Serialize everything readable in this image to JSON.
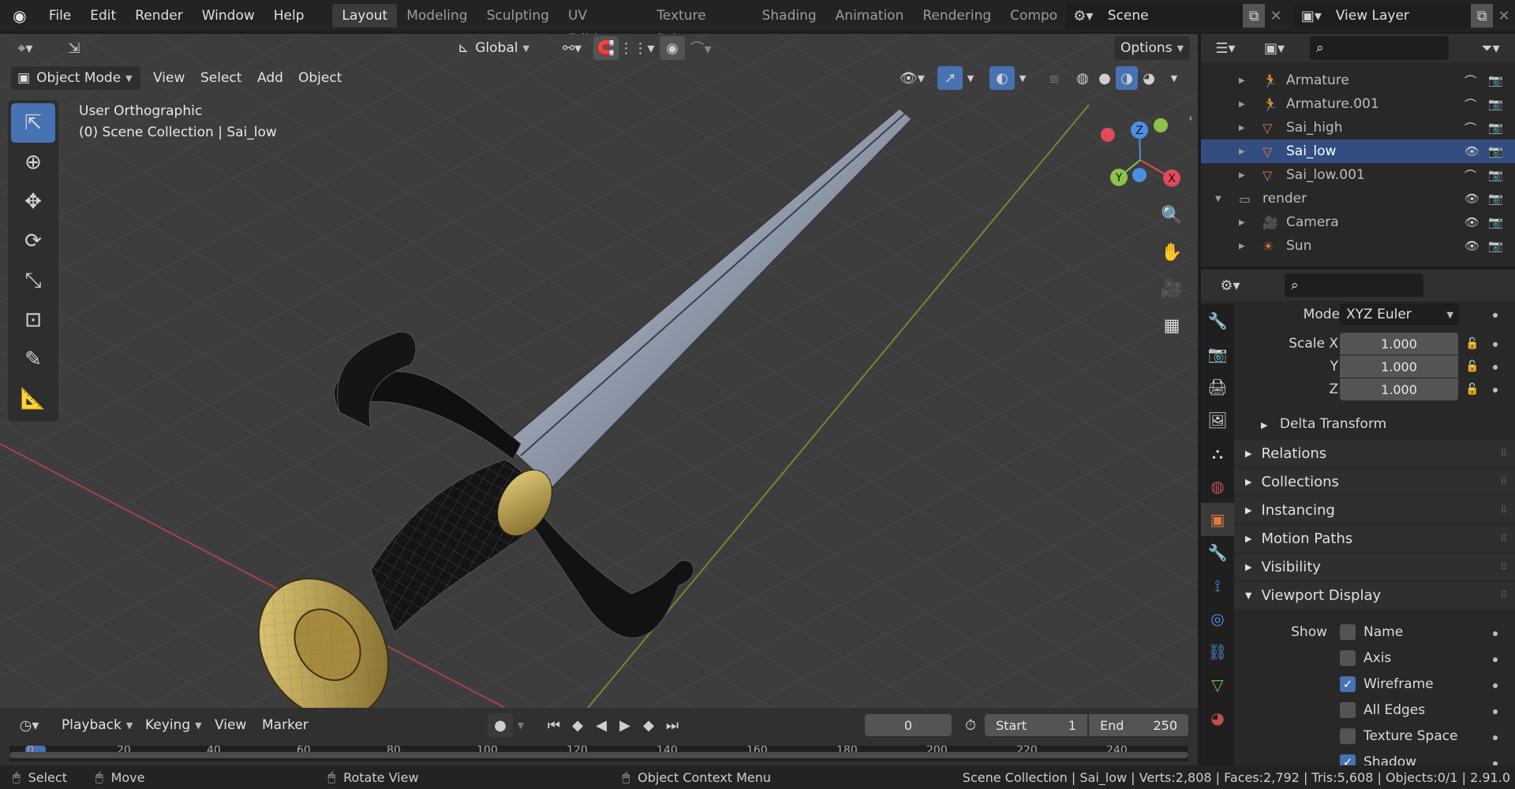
{
  "top_menu": [
    "File",
    "Edit",
    "Render",
    "Window",
    "Help"
  ],
  "workspace_tabs": [
    "Layout",
    "Modeling",
    "Sculpting",
    "UV Editing",
    "Texture Paint",
    "Shading",
    "Animation",
    "Rendering",
    "Compos"
  ],
  "scene_name": "Scene",
  "view_layer": "View Layer",
  "header": {
    "orientation": "Global",
    "options": "Options",
    "mode": "Object Mode",
    "menus": [
      "View",
      "Select",
      "Add",
      "Object"
    ]
  },
  "viewport": {
    "view_name": "User Orthographic",
    "collection_info": "(0) Scene Collection | Sai_low",
    "gizmo_axes": {
      "x": "X",
      "y": "Y",
      "z": "Z"
    }
  },
  "outliner": {
    "rows": [
      {
        "name": "Armature",
        "color": "#e07a3e"
      },
      {
        "name": "Armature.001",
        "color": "#e07a3e"
      },
      {
        "name": "Sai_high",
        "color": "#e07a3e"
      },
      {
        "name": "Sai_low",
        "color": "#e07a3e"
      },
      {
        "name": "Sai_low.001",
        "color": "#e07a3e"
      },
      {
        "name": "render",
        "color": "#9d9d9d"
      },
      {
        "name": "Camera",
        "color": "#e07a3e"
      },
      {
        "name": "Sun",
        "color": "#e07a3e"
      }
    ]
  },
  "properties": {
    "mode_label": "Mode",
    "mode_value": "XYZ Euler",
    "scale_x_label": "Scale X",
    "scale_y_label": "Y",
    "scale_z_label": "Z",
    "scale_x": "1.000",
    "scale_y": "1.000",
    "scale_z": "1.000",
    "delta_transform": "Delta Transform",
    "panels": [
      "Relations",
      "Collections",
      "Instancing",
      "Motion Paths",
      "Visibility",
      "Viewport Display"
    ],
    "show_label": "Show",
    "show_options": [
      {
        "label": "Name",
        "checked": false
      },
      {
        "label": "Axis",
        "checked": false
      },
      {
        "label": "Wireframe",
        "checked": true
      },
      {
        "label": "All Edges",
        "checked": false
      },
      {
        "label": "Texture Space",
        "checked": false
      },
      {
        "label": "Shadow",
        "checked": true
      }
    ]
  },
  "timeline": {
    "menus": [
      "Playback",
      "Keying",
      "View",
      "Marker"
    ],
    "current_frame": "0",
    "start_label": "Start",
    "start": "1",
    "end_label": "End",
    "end": "250",
    "ticks": [
      "0",
      "20",
      "40",
      "60",
      "80",
      "100",
      "120",
      "140",
      "160",
      "180",
      "200",
      "220",
      "240"
    ]
  },
  "statusbar": {
    "select": "Select",
    "move": "Move",
    "rotate": "Rotate View",
    "context": "Object Context Menu",
    "stats": "Scene Collection | Sai_low | Verts:2,808 | Faces:2,792 | Tris:5,608 | Objects:0/1 | 2.91.0"
  },
  "colors": {
    "accent": "#4772b3",
    "selected_row": "#334d80",
    "x_axis": "#e04a5a",
    "y_axis": "#8bc34a",
    "z_axis": "#4a90e2"
  }
}
